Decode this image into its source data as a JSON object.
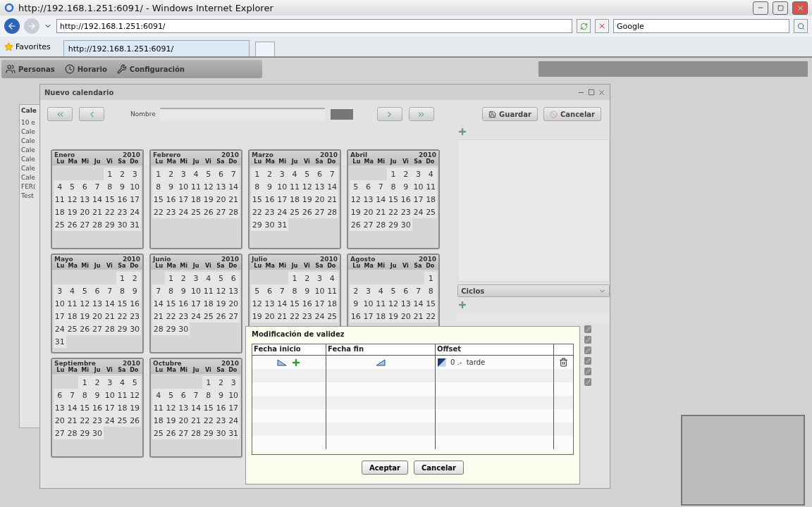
{
  "browser": {
    "title": "http://192.168.1.251:6091/ - Windows Internet Explorer",
    "address": "http://192.168.1.251:6091/",
    "search_engine": "Google",
    "favorites": "Favorites",
    "tab": "http://192.168.1.251:6091/"
  },
  "app_nav": [
    {
      "label": "Personas"
    },
    {
      "label": "Horario"
    },
    {
      "label": "Configuración"
    }
  ],
  "sidebar": {
    "title": "Cale",
    "items": [
      "10 e",
      "Cale",
      "Cale",
      "Cale",
      "Cale",
      "Cale",
      "Cale",
      "FER(",
      "Test"
    ]
  },
  "calendar_window": {
    "title": "Nuevo calendario",
    "name_label": "Nombre",
    "buttons": [
      "Guardar",
      "Cancelar"
    ],
    "cycles_label": "Ciclos",
    "months": [
      {
        "name": "Enero",
        "year": "2010",
        "weekdays": [
          "Lu",
          "Ma",
          "Mi",
          "Ju",
          "Vi",
          "Sa",
          "Do"
        ],
        "days": [
          "1",
          "2",
          "3",
          "4",
          "5",
          "6",
          "7",
          "8",
          "9",
          "10",
          "11",
          "12",
          "13",
          "14",
          "15",
          "16",
          "17",
          "18",
          "19",
          "20",
          "21",
          "22",
          "23",
          "24",
          "25",
          "26",
          "27",
          "28",
          "29",
          "30",
          "31"
        ]
      },
      {
        "name": "Febrero",
        "year": "2010",
        "weekdays": [
          "Lu",
          "Ma",
          "Mi",
          "Ju",
          "Vi",
          "Sa",
          "Do"
        ],
        "days": [
          "1",
          "2",
          "3",
          "4",
          "5",
          "6",
          "7",
          "8",
          "9",
          "10",
          "11",
          "12",
          "13",
          "14",
          "15",
          "16",
          "17",
          "18",
          "19",
          "20",
          "21",
          "22",
          "23",
          "24",
          "25",
          "26",
          "27",
          "28"
        ]
      },
      {
        "name": "Marzo",
        "year": "2010",
        "weekdays": [
          "Lu",
          "Ma",
          "Mi",
          "Ju",
          "Vi",
          "Sa",
          "Do"
        ],
        "days": [
          "1",
          "2",
          "3",
          "4",
          "5",
          "6",
          "7",
          "8",
          "9",
          "10",
          "11",
          "12",
          "13",
          "14",
          "15",
          "16",
          "17",
          "18",
          "19",
          "20",
          "21",
          "22",
          "23",
          "24",
          "25",
          "26",
          "27",
          "28",
          "29",
          "30",
          "31"
        ]
      },
      {
        "name": "Abril",
        "year": "2010",
        "weekdays": [
          "Lu",
          "Ma",
          "Mi",
          "Ju",
          "Vi",
          "Sa",
          "Do"
        ],
        "days": [
          "1",
          "2",
          "3",
          "4",
          "5",
          "6",
          "7",
          "8",
          "9",
          "10",
          "11",
          "12",
          "13",
          "14",
          "15",
          "16",
          "17",
          "18",
          "19",
          "20",
          "21",
          "22",
          "23",
          "24",
          "25",
          "26",
          "27",
          "28",
          "29",
          "30"
        ]
      },
      {
        "name": "Mayo",
        "year": "2010",
        "weekdays": [
          "Lu",
          "Ma",
          "Mi",
          "Ju",
          "Vi",
          "Sa",
          "Do"
        ],
        "days": [
          "1",
          "2",
          "3",
          "4",
          "5",
          "6",
          "7",
          "8",
          "9",
          "10",
          "11",
          "12",
          "13",
          "14",
          "15",
          "16",
          "17",
          "18",
          "19",
          "20",
          "21",
          "22",
          "23",
          "24",
          "25",
          "26",
          "27",
          "28",
          "29",
          "30",
          "31"
        ]
      },
      {
        "name": "Junio",
        "year": "2010",
        "weekdays": [
          "Lu",
          "Ma",
          "Mi",
          "Ju",
          "Vi",
          "Sa",
          "Do"
        ],
        "days": [
          "1",
          "2",
          "3",
          "4",
          "5",
          "6",
          "7",
          "8",
          "9",
          "10",
          "11",
          "12",
          "13",
          "14",
          "15",
          "16",
          "17",
          "18",
          "19",
          "20",
          "21",
          "22",
          "23",
          "24",
          "25",
          "26",
          "27",
          "28",
          "29",
          "30"
        ]
      },
      {
        "name": "Julio",
        "year": "2010",
        "weekdays": [
          "Lu",
          "Ma",
          "Mi",
          "Ju",
          "Vi",
          "Sa",
          "Do"
        ],
        "days": [
          "1",
          "2",
          "3",
          "4",
          "5",
          "6",
          "7",
          "8",
          "9",
          "10",
          "11",
          "12",
          "13",
          "14",
          "15",
          "16",
          "17",
          "18",
          "19",
          "20",
          "21",
          "22",
          "23",
          "24",
          "25"
        ]
      },
      {
        "name": "Agosto",
        "year": "2010",
        "weekdays": [
          "Lu",
          "Ma",
          "Mi",
          "Ju",
          "Vi",
          "Sa",
          "Do"
        ],
        "days": [
          "1",
          "2",
          "3",
          "4",
          "5",
          "6",
          "7",
          "8",
          "9",
          "10",
          "11",
          "12",
          "13",
          "14",
          "15",
          "16",
          "17",
          "18",
          "19",
          "20",
          "21",
          "22"
        ]
      },
      {
        "name": "Septiembre",
        "year": "2010",
        "weekdays": [
          "Lu",
          "Ma",
          "Mi",
          "Ju",
          "Vi",
          "Sa",
          "Do"
        ],
        "days": [
          "1",
          "2",
          "3",
          "4",
          "5",
          "6",
          "7",
          "8",
          "9",
          "10",
          "11",
          "12",
          "13",
          "14",
          "15",
          "16",
          "17",
          "18",
          "19",
          "20",
          "21",
          "22",
          "23",
          "24",
          "25",
          "26",
          "27",
          "28",
          "29",
          "30"
        ]
      },
      {
        "name": "Octubre",
        "year": "2010",
        "weekdays": [
          "Lu",
          "Ma",
          "Mi",
          "Ju",
          "Vi",
          "Sa",
          "Do"
        ],
        "days": [
          "1",
          "2",
          "3",
          "4",
          "5",
          "6",
          "7",
          "8",
          "9",
          "10",
          "11",
          "12",
          "13",
          "14",
          "15",
          "16",
          "17",
          "18",
          "19",
          "20",
          "21",
          "22",
          "23",
          "24",
          "25",
          "26",
          "27",
          "28",
          "29",
          "30",
          "31"
        ]
      }
    ]
  },
  "dialog": {
    "title": "Modificación de validez",
    "columns": [
      "Fecha inicio",
      "Fecha fin",
      "Offset"
    ],
    "rows": [
      {
        "offset": "0 .-  tarde"
      }
    ],
    "buttons": [
      "Aceptar",
      "Cancelar"
    ]
  }
}
